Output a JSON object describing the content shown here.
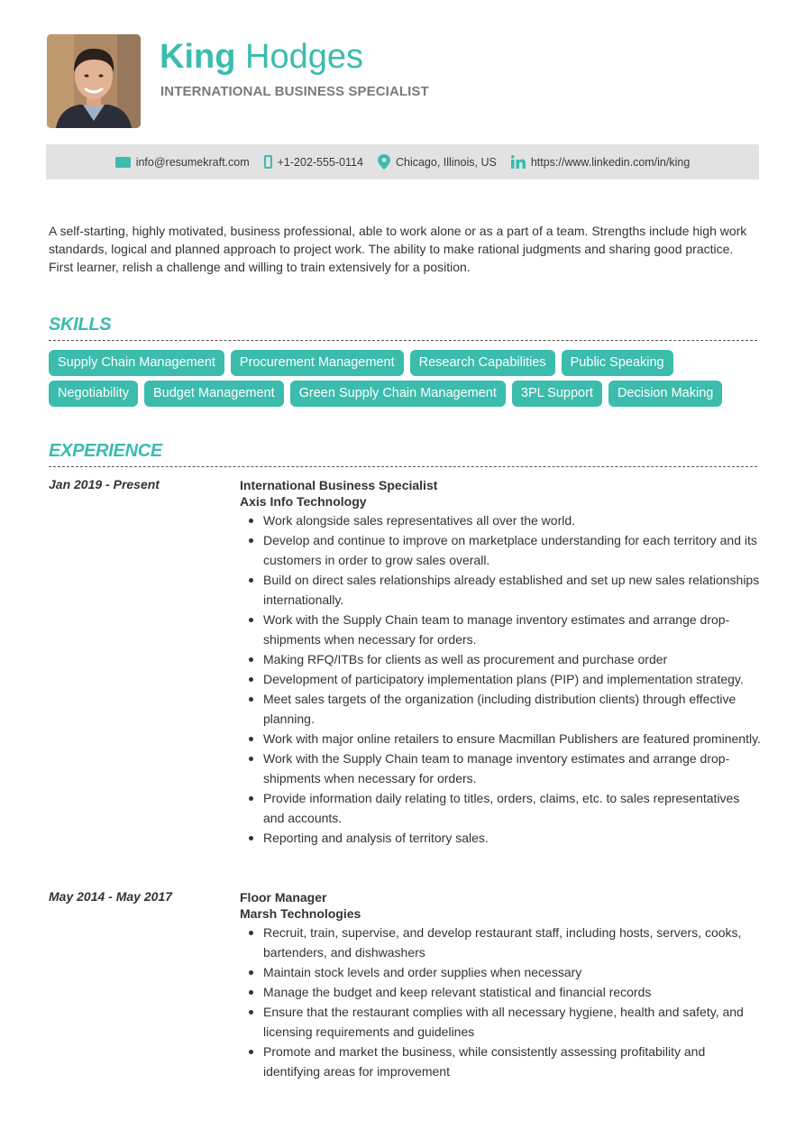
{
  "header": {
    "first_name": "King",
    "last_name": "Hodges",
    "title": "INTERNATIONAL BUSINESS SPECIALIST",
    "accent_color": "#3bbcad"
  },
  "contact": {
    "email": "info@resumekraft.com",
    "phone": "+1-202-555-0114",
    "location": "Chicago, Illinois, US",
    "linkedin": "https://www.linkedin.com/in/king",
    "icons": [
      "mail-icon",
      "phone-icon",
      "location-pin-icon",
      "linkedin-icon"
    ]
  },
  "summary": "A self-starting, highly motivated, business professional, able to work alone or as a part of a team. Strengths include high work standards, logical and planned approach to project work. The ability to make rational judgments and sharing good practice. First learner, relish a challenge and willing to train extensively for a position.",
  "skills": {
    "heading": "SKILLS",
    "rows": [
      [
        "Supply Chain Management",
        "Procurement Management",
        "Research Capabilities",
        "Public Speaking"
      ],
      [
        "Negotiability",
        "Budget Management",
        "Green Supply Chain Management",
        "3PL Support",
        "Decision Making"
      ]
    ]
  },
  "experience": {
    "heading": "EXPERIENCE",
    "jobs": [
      {
        "date": "Jan 2019 - Present",
        "title": "International Business Specialist",
        "company": "Axis Info Technology",
        "bullets": [
          "Work alongside sales representatives all over the world.",
          "Develop and continue to improve on marketplace understanding for each territory and its customers in order to grow sales overall.",
          "Build on direct sales relationships already established and set up new sales relationships internationally.",
          "Work with the Supply Chain team to manage inventory estimates and arrange drop-shipments when necessary for orders.",
          "Making RFQ/ITBs for clients as well as procurement and purchase order",
          "Development of participatory implementation plans (PIP) and implementation strategy.",
          "Meet sales targets of the organization (including distribution clients) through effective planning.",
          "Work with major online retailers to ensure Macmillan Publishers are featured prominently.",
          "Work with the Supply Chain team to manage inventory estimates and arrange drop-shipments when necessary for orders.",
          "Provide information daily relating to titles, orders, claims, etc. to sales representatives and accounts.",
          "Reporting and analysis of territory sales."
        ]
      },
      {
        "date": "May 2014 - May 2017",
        "title": "Floor Manager",
        "company": "Marsh Technologies",
        "bullets": [
          "Recruit, train, supervise, and develop restaurant staff, including hosts, servers, cooks, bartenders, and dishwashers",
          "Maintain stock levels and order supplies when necessary",
          "Manage the budget and keep relevant statistical and financial records",
          "Ensure that the restaurant complies with all necessary hygiene, health and safety, and licensing requirements and guidelines",
          "Promote and market the business, while consistently assessing profitability and identifying areas for improvement"
        ]
      }
    ]
  }
}
